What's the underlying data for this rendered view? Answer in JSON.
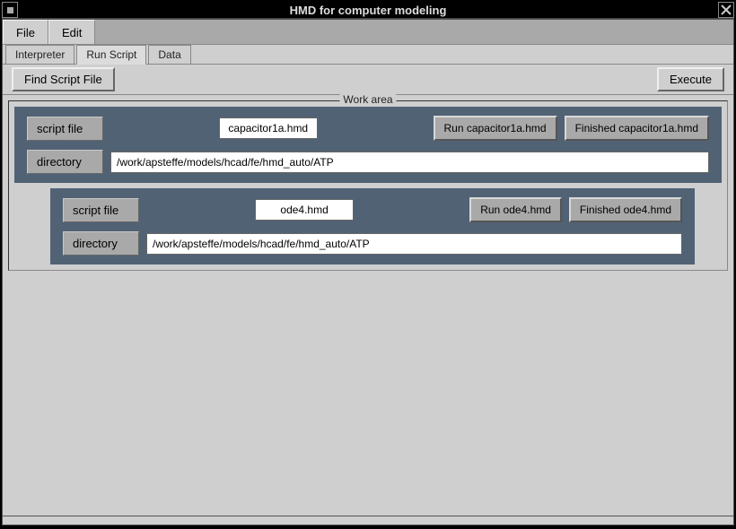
{
  "title": "HMD for computer modeling",
  "menu": {
    "file": "File",
    "edit": "Edit"
  },
  "tabs": {
    "interpreter": "Interpreter",
    "run_script": "Run Script",
    "data": "Data"
  },
  "toolbar": {
    "find_script": "Find Script File",
    "execute": "Execute"
  },
  "workarea_label": "Work area",
  "labels": {
    "script_file": "script file",
    "directory": "directory"
  },
  "panels": [
    {
      "script": "capacitor1a.hmd",
      "run_btn": "Run capacitor1a.hmd",
      "done_btn": "Finished  capacitor1a.hmd",
      "directory": "/work/apsteffe/models/hcad/fe/hmd_auto/ATP"
    },
    {
      "script": "ode4.hmd",
      "run_btn": "Run ode4.hmd",
      "done_btn": "Finished  ode4.hmd",
      "directory": "/work/apsteffe/models/hcad/fe/hmd_auto/ATP"
    }
  ]
}
